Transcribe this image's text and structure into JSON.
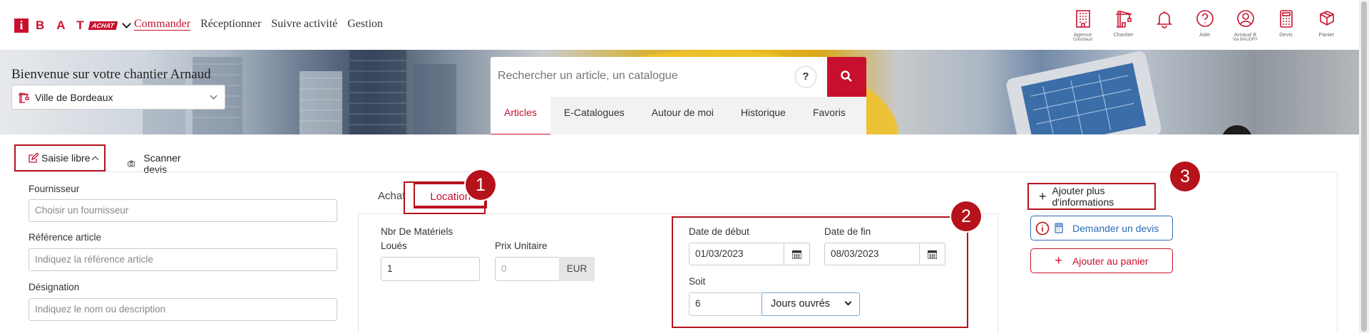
{
  "brand": {
    "letters": "BAT",
    "badge": "ACHAT"
  },
  "nav": [
    "Commander",
    "Réceptionner",
    "Suivre activité",
    "Gestion"
  ],
  "nav_active": "Commander",
  "tools": [
    {
      "icon": "building-icon",
      "label": "Agence",
      "sub": "Gourdaud"
    },
    {
      "icon": "crane-icon",
      "label": "Chantier",
      "sub": ""
    },
    {
      "icon": "bell-icon",
      "label": "",
      "sub": ""
    },
    {
      "icon": "help-icon",
      "label": "Aide",
      "sub": ""
    },
    {
      "icon": "user-icon",
      "label": "Arnaud B",
      "sub": "Via BAUDRY"
    },
    {
      "icon": "calculator-icon",
      "label": "Devis",
      "sub": ""
    },
    {
      "icon": "cart-icon",
      "label": "Panier",
      "sub": ""
    }
  ],
  "banner": {
    "welcome": "Bienvenue sur votre chantier Arnaud",
    "site": "Ville de Bordeaux"
  },
  "search": {
    "placeholder": "Rechercher un article, un catalogue",
    "help": "?",
    "tabs": [
      "Articles",
      "E-Catalogues",
      "Autour de moi",
      "Historique",
      "Favoris"
    ],
    "active_tab": "Articles"
  },
  "modes": {
    "saisie": "Saisie libre",
    "scan": "Scanner devis"
  },
  "form": {
    "fournisseur_label": "Fournisseur",
    "fournisseur_placeholder": "Choisir un fournisseur",
    "reference_label": "Référence article",
    "reference_placeholder": "Indiquez la référence article",
    "designation_label": "Désignation",
    "designation_placeholder": "Indiquez le nom ou description"
  },
  "purchase_tabs": {
    "achat": "Achat",
    "location": "Location"
  },
  "location": {
    "nbr_label_1": "Nbr De Matériels",
    "nbr_label_2": "Loués",
    "nbr_value": "1",
    "prix_label": "Prix Unitaire",
    "prix_placeholder": "0",
    "currency": "EUR",
    "date_debut_label": "Date de début",
    "date_debut": "01/03/2023",
    "date_fin_label": "Date de fin",
    "date_fin": "08/03/2023",
    "soit_label": "Soit",
    "soit_value": "6",
    "unit": "Jours ouvrés"
  },
  "actions": {
    "more_info": "Ajouter plus d'informations",
    "devis": "Demander un devis",
    "panier": "Ajouter au panier"
  },
  "callouts": [
    "1",
    "2",
    "3"
  ],
  "colors": {
    "accent": "#c8102e",
    "highlight": "#b5121b",
    "link_blue": "#2e6ab8"
  }
}
